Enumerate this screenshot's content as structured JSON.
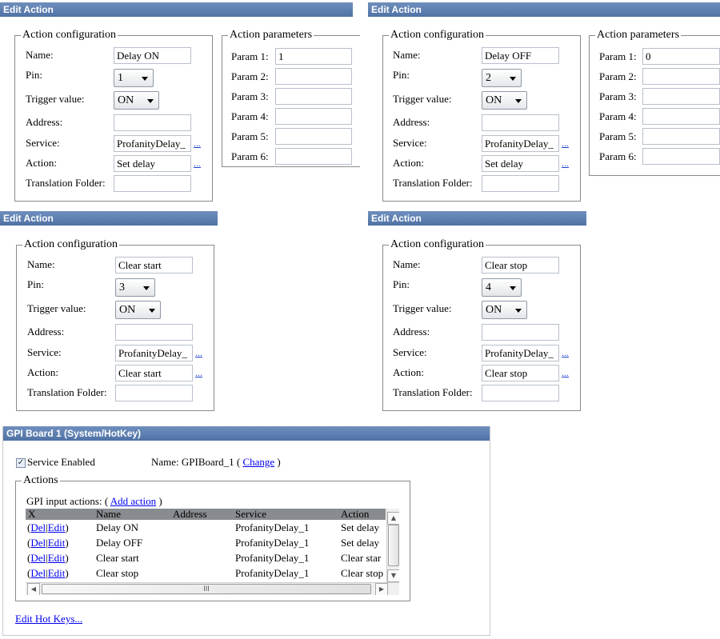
{
  "edit_actions": [
    {
      "title": "Edit Action",
      "config_legend": "Action configuration",
      "labels": {
        "name": "Name:",
        "pin": "Pin:",
        "trigger": "Trigger value:",
        "address": "Address:",
        "service": "Service:",
        "action": "Action:",
        "translation": "Translation Folder:"
      },
      "name": "Delay ON",
      "pin": "1",
      "trigger": "ON",
      "address": "",
      "service": "ProfanityDelay_",
      "action": "Set delay",
      "translation": "",
      "params_legend": "Action parameters",
      "params": [
        {
          "label": "Param 1:",
          "value": "1"
        },
        {
          "label": "Param 2:",
          "value": ""
        },
        {
          "label": "Param 3:",
          "value": ""
        },
        {
          "label": "Param 4:",
          "value": ""
        },
        {
          "label": "Param 5:",
          "value": ""
        },
        {
          "label": "Param 6:",
          "value": ""
        }
      ]
    },
    {
      "title": "Edit Action",
      "config_legend": "Action configuration",
      "labels": {
        "name": "Name:",
        "pin": "Pin:",
        "trigger": "Trigger value:",
        "address": "Address:",
        "service": "Service:",
        "action": "Action:",
        "translation": "Translation Folder:"
      },
      "name": "Delay OFF",
      "pin": "2",
      "trigger": "ON",
      "address": "",
      "service": "ProfanityDelay_",
      "action": "Set delay",
      "translation": "",
      "params_legend": "Action parameters",
      "params": [
        {
          "label": "Param 1:",
          "value": "0"
        },
        {
          "label": "Param 2:",
          "value": ""
        },
        {
          "label": "Param 3:",
          "value": ""
        },
        {
          "label": "Param 4:",
          "value": ""
        },
        {
          "label": "Param 5:",
          "value": ""
        },
        {
          "label": "Param 6:",
          "value": ""
        }
      ]
    },
    {
      "title": "Edit Action",
      "config_legend": "Action configuration",
      "labels": {
        "name": "Name:",
        "pin": "Pin:",
        "trigger": "Trigger value:",
        "address": "Address:",
        "service": "Service:",
        "action": "Action:",
        "translation": "Translation Folder:"
      },
      "name": "Clear start",
      "pin": "3",
      "trigger": "ON",
      "address": "",
      "service": "ProfanityDelay_",
      "action": "Clear start",
      "translation": ""
    },
    {
      "title": "Edit Action",
      "config_legend": "Action configuration",
      "labels": {
        "name": "Name:",
        "pin": "Pin:",
        "trigger": "Trigger value:",
        "address": "Address:",
        "service": "Service:",
        "action": "Action:",
        "translation": "Translation Folder:"
      },
      "name": "Clear stop",
      "pin": "4",
      "trigger": "ON",
      "address": "",
      "service": "ProfanityDelay_",
      "action": "Clear stop",
      "translation": ""
    }
  ],
  "ellipsis": "...",
  "gpi": {
    "title": "GPI Board 1 (System/HotKey)",
    "service_enabled_label": "Service Enabled",
    "name_label": "Name: GPIBoard_1 (",
    "change_link": "Change",
    "name_close": ")",
    "actions_legend": "Actions",
    "gpi_input_label": "GPI input actions: (",
    "add_action_link": "Add action",
    "gpi_input_close": ")",
    "columns": [
      "X",
      "Name",
      "Address",
      "Service",
      "Action"
    ],
    "rows": [
      {
        "open": "(",
        "del": "Del",
        "sep": "|",
        "edit": "Edit",
        "close": ")",
        "name": "Delay ON",
        "address": "",
        "service": "ProfanityDelay_1",
        "action": "Set delay"
      },
      {
        "open": "(",
        "del": "Del",
        "sep": "|",
        "edit": "Edit",
        "close": ")",
        "name": "Delay OFF",
        "address": "",
        "service": "ProfanityDelay_1",
        "action": "Set delay"
      },
      {
        "open": "(",
        "del": "Del",
        "sep": "|",
        "edit": "Edit",
        "close": ")",
        "name": "Clear start",
        "address": "",
        "service": "ProfanityDelay_1",
        "action": "Clear star"
      },
      {
        "open": "(",
        "del": "Del",
        "sep": "|",
        "edit": "Edit",
        "close": ")",
        "name": "Clear stop",
        "address": "",
        "service": "ProfanityDelay_1",
        "action": "Clear stop"
      }
    ],
    "hscroll_grip": "III",
    "edit_hotkeys_link": "Edit Hot Keys..."
  },
  "icons": {
    "checkbox": "check-icon",
    "scroll_up": "arrow-up-icon",
    "scroll_down": "arrow-down-icon",
    "scroll_left": "arrow-left-icon",
    "scroll_right": "arrow-right-icon",
    "dropdown": "chevron-down-icon"
  },
  "colors": {
    "titlebar": "#5b7db3",
    "link": "#0000ee",
    "table_header": "#888b8f"
  }
}
